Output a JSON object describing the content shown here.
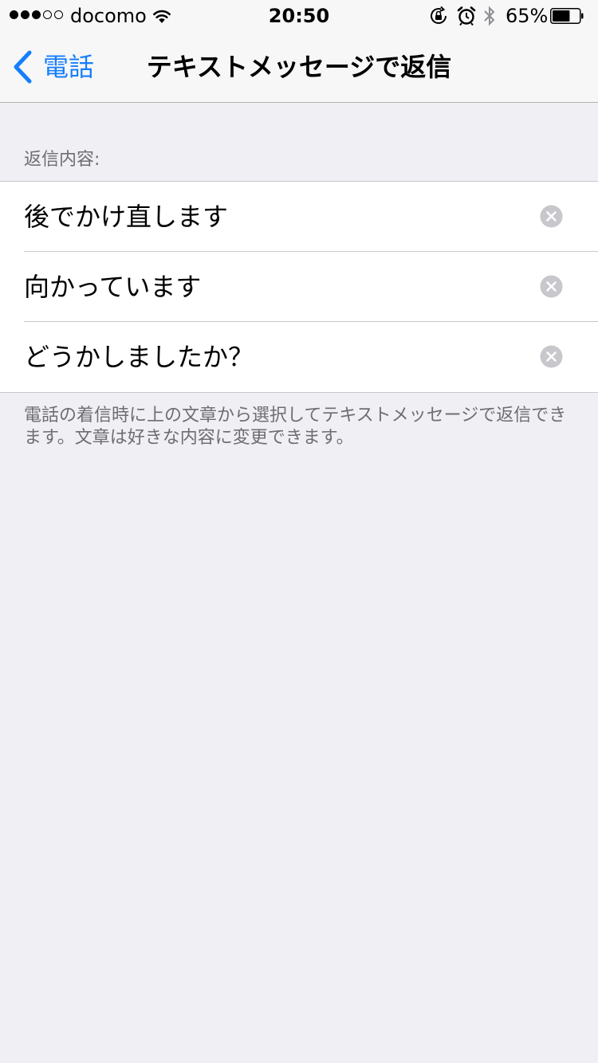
{
  "status_bar": {
    "signal_dots": [
      true,
      true,
      true,
      false,
      false
    ],
    "carrier": "docomo",
    "time": "20:50",
    "battery_percent": "65%",
    "battery_level": 0.65,
    "icons": [
      "wifi-icon",
      "rotation-lock-icon",
      "alarm-icon",
      "bluetooth-icon",
      "battery-icon"
    ]
  },
  "nav": {
    "back_label": "電話",
    "title": "テキストメッセージで返信"
  },
  "section": {
    "header": "返信内容:",
    "items": [
      {
        "text": "後でかけ直します"
      },
      {
        "text": "向かっています"
      },
      {
        "text": "どうかしましたか？"
      }
    ],
    "footer": "電話の着信時に上の文章から選択してテキストメッセージで返信できます。文章は好きな内容に変更できます。"
  },
  "colors": {
    "accent": "#157efb",
    "background": "#efeff4",
    "secondary_text": "#6d6d72",
    "clear_icon": "#c7c7cc"
  }
}
